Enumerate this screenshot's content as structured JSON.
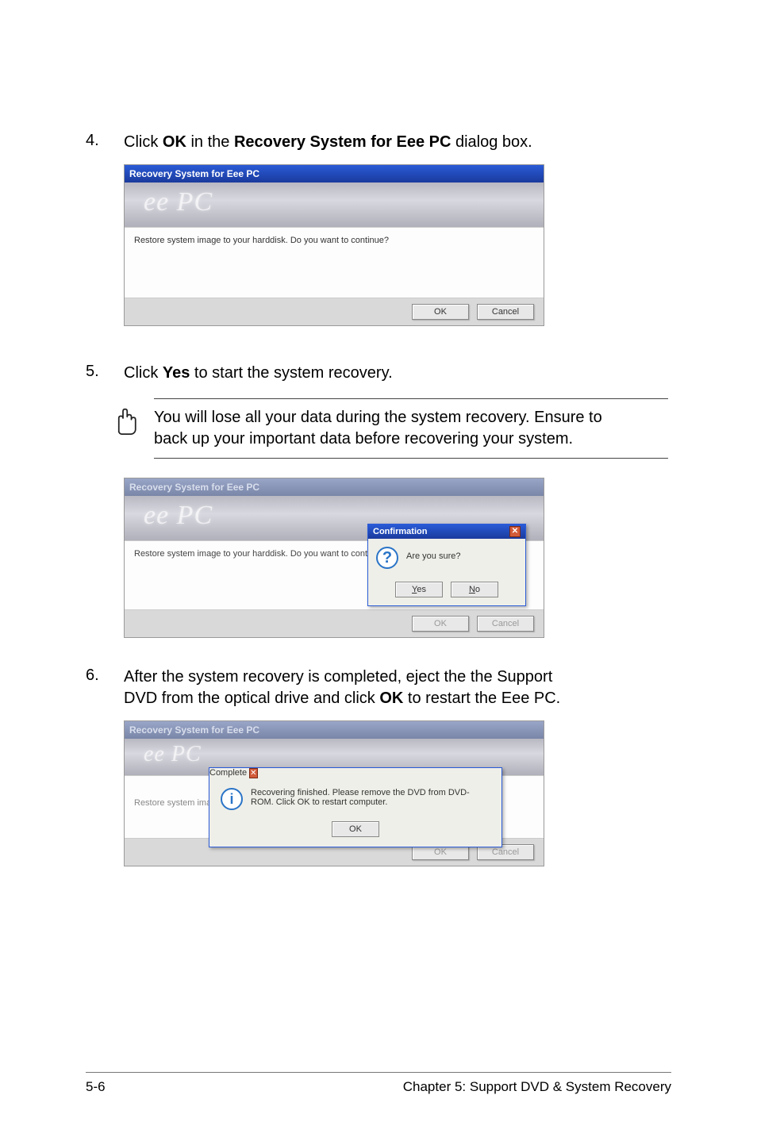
{
  "steps": {
    "s4": {
      "num": "4.",
      "pre": "Click ",
      "bold1": "OK",
      "mid": " in the ",
      "bold2": "Recovery System for Eee PC",
      "post": " dialog box."
    },
    "s5": {
      "num": "5.",
      "pre": "Click ",
      "bold1": "Yes",
      "post": " to start the system recovery."
    },
    "s6": {
      "num": "6.",
      "line1a": "After the system recovery is completed, eject the the Support",
      "line2a": "DVD from the optical drive and click ",
      "bold": "OK",
      "line2b": " to restart the Eee PC."
    }
  },
  "note": {
    "line1": "You will lose all your data during the system recovery. Ensure to",
    "line2": "back up your important data before recovering your system."
  },
  "dialog": {
    "title_active": "Recovery System for Eee PC",
    "title_inactive": "Recovery System for Eee PC",
    "banner_logo": "ee PC",
    "body_text": "Restore system image to your harddisk. Do you want to continue?",
    "body_text_restore": "Restore system ima",
    "ok": "OK",
    "cancel": "Cancel"
  },
  "confirm_modal": {
    "title": "Confirmation",
    "question": "Are you sure?",
    "yes_u": "Y",
    "yes_rest": "es",
    "no_u": "N",
    "no_rest": "o"
  },
  "complete_modal": {
    "title": "Complete",
    "line": "Recovering finished. Please remove the DVD from DVD-ROM. Click OK to restart computer.",
    "ok": "OK"
  },
  "footer": {
    "left": "5-6",
    "right": "Chapter 5: Support DVD & System Recovery"
  },
  "icons": {
    "question": "?",
    "info": "i",
    "close": "✕"
  }
}
